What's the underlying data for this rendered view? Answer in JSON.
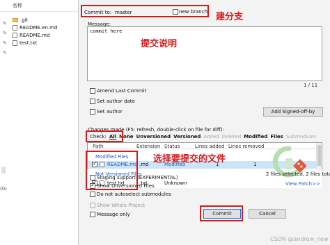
{
  "explorer": {
    "header": "名称",
    "items": [
      ".git",
      "README.en.md",
      "README.md",
      "test.txt"
    ],
    "left_fragment": "(G:"
  },
  "dialog": {
    "commit_to_label": "Commit to:",
    "branch": "master",
    "new_branch_label": "new branch",
    "message_label": "Message:",
    "message_text": "commit here",
    "counter": "1 / 11",
    "amend_label": "Amend Last Commit",
    "set_author_date_label": "Set author date",
    "set_author_label": "Set author",
    "add_signoff_label": "Add Signed-off-by",
    "changes_label": "Changes made (F5: refresh, double-click on file for diff):",
    "check_label": "Check:",
    "filters": [
      "All",
      "None",
      "Unversioned",
      "Versioned",
      "Added",
      "Deleted",
      "Modified",
      "Files",
      "Submodules"
    ],
    "columns": [
      "Path",
      "Extension",
      "Status",
      "Lines added",
      "Lines removed"
    ],
    "group_modified": "Modified Files",
    "group_unversioned": "Not Versioned Files",
    "rows": [
      {
        "path": "README.md",
        "extension": ".md",
        "status": "Modified",
        "added": "1",
        "removed": "1"
      },
      {
        "path": "test.txt",
        "extension": ".txt",
        "status": "Unknown",
        "added": "",
        "removed": ""
      }
    ],
    "files_summary": "2 files selected, 2 files total",
    "view_patch": "View Patch>>",
    "staging_label": "Staging support (EXPERIMENTAL)",
    "show_unversioned_label": "Show Unversioned Files",
    "no_autoselect_label": "Do not autoselect submodules",
    "show_whole_project_label": "Show Whole Project",
    "message_only_label": "Message only",
    "commit_button": "Commit",
    "cancel_button": "Cancel"
  },
  "annotations": {
    "new_branch_note": "建分支",
    "message_note": "提交说明",
    "select_files_note": "选择要提交的文件"
  },
  "watermark": "CSDN @andrew_new"
}
